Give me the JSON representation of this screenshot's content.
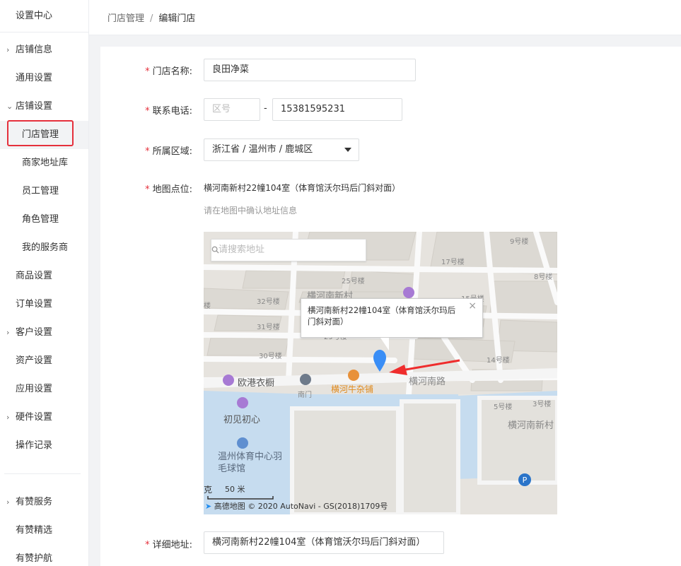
{
  "sidebar": {
    "title": "设置中心",
    "items": [
      {
        "label": "店铺信息",
        "chevron": "›"
      },
      {
        "label": "通用设置",
        "chevron": ""
      },
      {
        "label": "店铺设置",
        "chevron": "⌄"
      },
      {
        "label": "门店管理",
        "chevron": ""
      },
      {
        "label": "商家地址库",
        "chevron": ""
      },
      {
        "label": "员工管理",
        "chevron": ""
      },
      {
        "label": "角色管理",
        "chevron": ""
      },
      {
        "label": "我的服务商",
        "chevron": ""
      },
      {
        "label": "商品设置",
        "chevron": ""
      },
      {
        "label": "订单设置",
        "chevron": ""
      },
      {
        "label": "客户设置",
        "chevron": "›"
      },
      {
        "label": "资产设置",
        "chevron": ""
      },
      {
        "label": "应用设置",
        "chevron": ""
      },
      {
        "label": "硬件设置",
        "chevron": "›"
      },
      {
        "label": "操作记录",
        "chevron": ""
      },
      {
        "label": "有赞服务",
        "chevron": "›"
      },
      {
        "label": "有赞精选",
        "chevron": ""
      },
      {
        "label": "有赞护航",
        "chevron": ""
      }
    ]
  },
  "breadcrumb": {
    "parent": "门店管理",
    "separator": "/",
    "current": "编辑门店"
  },
  "form": {
    "required_mark": "*",
    "name": {
      "label": "门店名称:",
      "value": "良田净菜"
    },
    "phone": {
      "label": "联系电话:",
      "area_placeholder": "区号",
      "dash": "-",
      "number": "15381595231"
    },
    "region": {
      "label": "所属区域:",
      "value": "浙江省 / 温州市 / 鹿城区"
    },
    "map_point": {
      "label": "地图点位:",
      "address": "横河南新村22幢104室（体育馆沃尔玛后门斜对面）",
      "hint": "请在地图中确认地址信息"
    },
    "detail_address": {
      "label": "详细地址:",
      "value": "横河南新村22幢104室（体育馆沃尔玛后门斜对面）"
    }
  },
  "map": {
    "search_placeholder": "请搜索地址",
    "bubble_text": "横河南新村22幢104室（体育馆沃尔玛后门斜对面）",
    "bubble_close": "×",
    "labels": {
      "b9": "9号楼",
      "b17": "17号楼",
      "b8": "8号楼",
      "b25": "25号楼",
      "b32": "32号楼",
      "b31": "31号楼",
      "b30": "30号楼",
      "b14": "14号楼",
      "b5": "5号楼",
      "b3": "3号楼",
      "lou_left": "楼",
      "hehe_north": "横河南新村",
      "b15_partial": "15号楼",
      "b29_partial": "29号楼",
      "road": "横河南路",
      "shop_orange": "横河牛杂铺",
      "oucang": "欧港衣橱",
      "nanmen": "南门",
      "chujian": "初见初心",
      "tiyu": "温州体育中心羽毛球馆",
      "hehe_south": "横河南新村",
      "ke": "克"
    },
    "scale": "50 米",
    "copyright": "高德地图 © 2020 AutoNavi - GS(2018)1709号"
  },
  "colors": {
    "required": "#e5303c",
    "accent_red": "#e5303c",
    "marker": "#3a8ef6",
    "water": "#c6dcef",
    "orange": "#e08a1c"
  }
}
